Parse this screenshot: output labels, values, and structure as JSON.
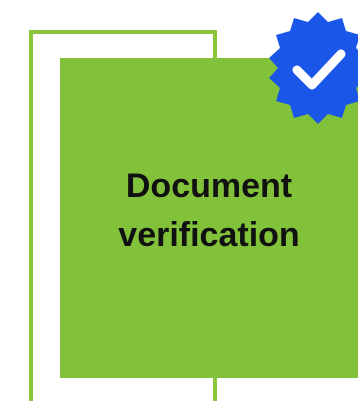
{
  "card": {
    "title_line1": "Document",
    "title_line2": "verification"
  },
  "badge": {
    "icon": "verified-check-icon",
    "color": "#1a56e8",
    "check_color": "#ffffff"
  },
  "colors": {
    "card_green": "#82c23a",
    "frame_green": "#8bc63a",
    "background": "#ffffff",
    "text": "#111111"
  }
}
